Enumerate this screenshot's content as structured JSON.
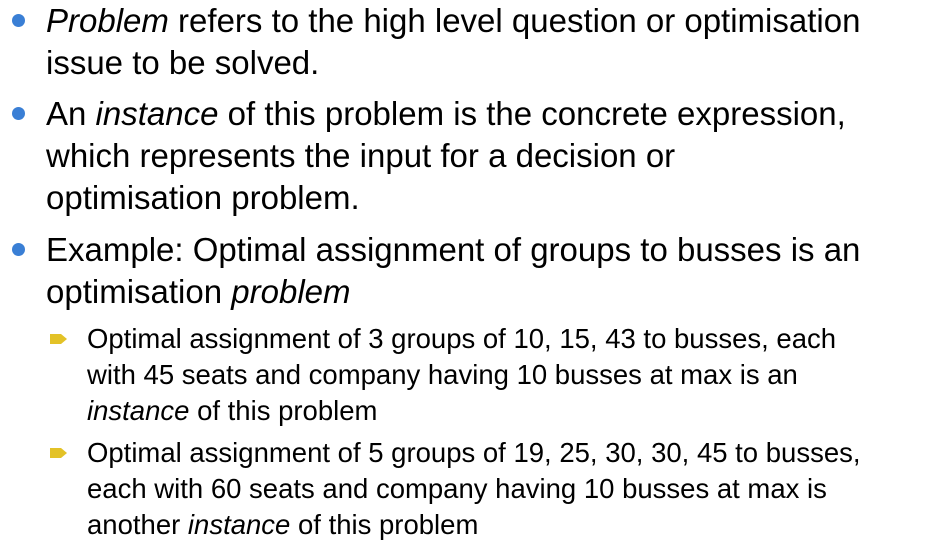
{
  "bullets": [
    {
      "lines": [
        {
          "parts": [
            {
              "text": "Problem",
              "italic": true
            },
            {
              "text": " refers to the high level question or optimisation"
            }
          ]
        },
        {
          "parts": [
            {
              "text": "issue to be solved."
            }
          ]
        }
      ]
    },
    {
      "lines": [
        {
          "parts": [
            {
              "text": "An "
            },
            {
              "text": "instance",
              "italic": true
            },
            {
              "text": " of this problem is the concrete expression,"
            }
          ]
        },
        {
          "parts": [
            {
              "text": "which represents the input for a decision or"
            }
          ]
        },
        {
          "parts": [
            {
              "text": "optimisation problem."
            }
          ]
        }
      ]
    },
    {
      "lines": [
        {
          "parts": [
            {
              "text": "Example: Optimal assignment of groups to busses is an"
            }
          ]
        },
        {
          "parts": [
            {
              "text": "optimisation "
            },
            {
              "text": "problem",
              "italic": true
            }
          ]
        }
      ]
    }
  ],
  "sub_bullets": [
    {
      "lines": [
        {
          "parts": [
            {
              "text": "Optimal assignment of 3 groups of 10, 15, 43 to  busses, each"
            }
          ]
        },
        {
          "parts": [
            {
              "text": "with 45 seats and company having 10 busses at max is an"
            }
          ]
        },
        {
          "parts": [
            {
              "text": "instance",
              "italic": true
            },
            {
              "text": " of this problem"
            }
          ]
        }
      ]
    },
    {
      "lines": [
        {
          "parts": [
            {
              "text": "Optimal assignment of 5 groups of 19, 25, 30, 30, 45 to busses,"
            }
          ]
        },
        {
          "parts": [
            {
              "text": "each with 60 seats and company having 10 busses at max is"
            }
          ]
        },
        {
          "parts": [
            {
              "text": "another "
            },
            {
              "text": "instance",
              "italic": true
            },
            {
              "text": " of this problem"
            }
          ]
        }
      ]
    }
  ],
  "colors": {
    "bullet_dot": "#3a7fd5",
    "sub_bullet_arrow": "#e3c227",
    "text": "#000000"
  },
  "icons": {
    "bullet": "bullet-dot-icon",
    "sub_bullet": "arrow-bullet-icon"
  }
}
